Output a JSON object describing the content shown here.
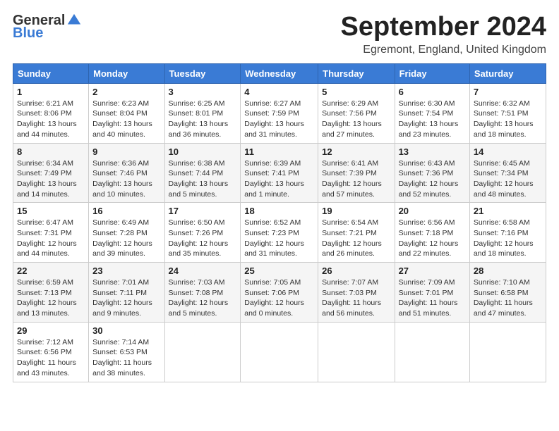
{
  "header": {
    "logo": {
      "general": "General",
      "blue": "Blue"
    },
    "month": "September 2024",
    "location": "Egremont, England, United Kingdom"
  },
  "weekdays": [
    "Sunday",
    "Monday",
    "Tuesday",
    "Wednesday",
    "Thursday",
    "Friday",
    "Saturday"
  ],
  "weeks": [
    [
      {
        "day": "1",
        "sunrise": "6:21 AM",
        "sunset": "8:06 PM",
        "daylight": "13 hours and 44 minutes."
      },
      {
        "day": "2",
        "sunrise": "6:23 AM",
        "sunset": "8:04 PM",
        "daylight": "13 hours and 40 minutes."
      },
      {
        "day": "3",
        "sunrise": "6:25 AM",
        "sunset": "8:01 PM",
        "daylight": "13 hours and 36 minutes."
      },
      {
        "day": "4",
        "sunrise": "6:27 AM",
        "sunset": "7:59 PM",
        "daylight": "13 hours and 31 minutes."
      },
      {
        "day": "5",
        "sunrise": "6:29 AM",
        "sunset": "7:56 PM",
        "daylight": "13 hours and 27 minutes."
      },
      {
        "day": "6",
        "sunrise": "6:30 AM",
        "sunset": "7:54 PM",
        "daylight": "13 hours and 23 minutes."
      },
      {
        "day": "7",
        "sunrise": "6:32 AM",
        "sunset": "7:51 PM",
        "daylight": "13 hours and 18 minutes."
      }
    ],
    [
      {
        "day": "8",
        "sunrise": "6:34 AM",
        "sunset": "7:49 PM",
        "daylight": "13 hours and 14 minutes."
      },
      {
        "day": "9",
        "sunrise": "6:36 AM",
        "sunset": "7:46 PM",
        "daylight": "13 hours and 10 minutes."
      },
      {
        "day": "10",
        "sunrise": "6:38 AM",
        "sunset": "7:44 PM",
        "daylight": "13 hours and 5 minutes."
      },
      {
        "day": "11",
        "sunrise": "6:39 AM",
        "sunset": "7:41 PM",
        "daylight": "13 hours and 1 minute."
      },
      {
        "day": "12",
        "sunrise": "6:41 AM",
        "sunset": "7:39 PM",
        "daylight": "12 hours and 57 minutes."
      },
      {
        "day": "13",
        "sunrise": "6:43 AM",
        "sunset": "7:36 PM",
        "daylight": "12 hours and 52 minutes."
      },
      {
        "day": "14",
        "sunrise": "6:45 AM",
        "sunset": "7:34 PM",
        "daylight": "12 hours and 48 minutes."
      }
    ],
    [
      {
        "day": "15",
        "sunrise": "6:47 AM",
        "sunset": "7:31 PM",
        "daylight": "12 hours and 44 minutes."
      },
      {
        "day": "16",
        "sunrise": "6:49 AM",
        "sunset": "7:28 PM",
        "daylight": "12 hours and 39 minutes."
      },
      {
        "day": "17",
        "sunrise": "6:50 AM",
        "sunset": "7:26 PM",
        "daylight": "12 hours and 35 minutes."
      },
      {
        "day": "18",
        "sunrise": "6:52 AM",
        "sunset": "7:23 PM",
        "daylight": "12 hours and 31 minutes."
      },
      {
        "day": "19",
        "sunrise": "6:54 AM",
        "sunset": "7:21 PM",
        "daylight": "12 hours and 26 minutes."
      },
      {
        "day": "20",
        "sunrise": "6:56 AM",
        "sunset": "7:18 PM",
        "daylight": "12 hours and 22 minutes."
      },
      {
        "day": "21",
        "sunrise": "6:58 AM",
        "sunset": "7:16 PM",
        "daylight": "12 hours and 18 minutes."
      }
    ],
    [
      {
        "day": "22",
        "sunrise": "6:59 AM",
        "sunset": "7:13 PM",
        "daylight": "12 hours and 13 minutes."
      },
      {
        "day": "23",
        "sunrise": "7:01 AM",
        "sunset": "7:11 PM",
        "daylight": "12 hours and 9 minutes."
      },
      {
        "day": "24",
        "sunrise": "7:03 AM",
        "sunset": "7:08 PM",
        "daylight": "12 hours and 5 minutes."
      },
      {
        "day": "25",
        "sunrise": "7:05 AM",
        "sunset": "7:06 PM",
        "daylight": "12 hours and 0 minutes."
      },
      {
        "day": "26",
        "sunrise": "7:07 AM",
        "sunset": "7:03 PM",
        "daylight": "11 hours and 56 minutes."
      },
      {
        "day": "27",
        "sunrise": "7:09 AM",
        "sunset": "7:01 PM",
        "daylight": "11 hours and 51 minutes."
      },
      {
        "day": "28",
        "sunrise": "7:10 AM",
        "sunset": "6:58 PM",
        "daylight": "11 hours and 47 minutes."
      }
    ],
    [
      {
        "day": "29",
        "sunrise": "7:12 AM",
        "sunset": "6:56 PM",
        "daylight": "11 hours and 43 minutes."
      },
      {
        "day": "30",
        "sunrise": "7:14 AM",
        "sunset": "6:53 PM",
        "daylight": "11 hours and 38 minutes."
      },
      null,
      null,
      null,
      null,
      null
    ]
  ]
}
